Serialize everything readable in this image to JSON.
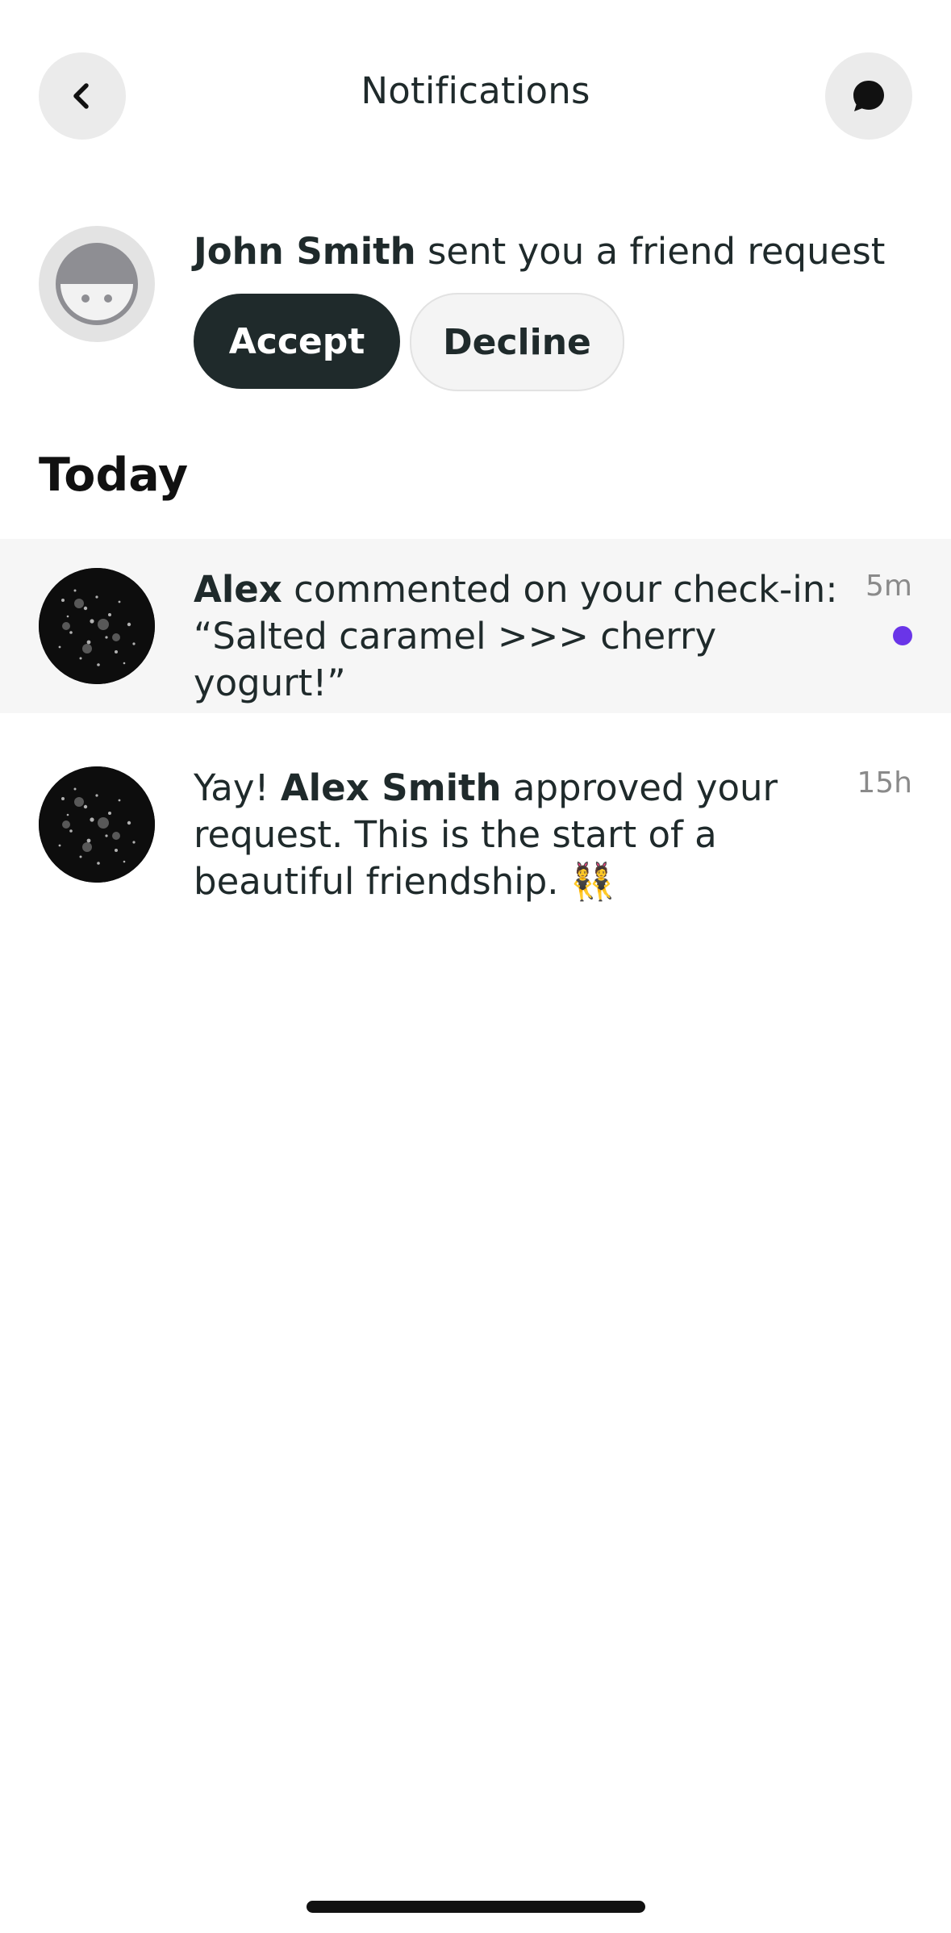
{
  "header": {
    "title": "Notifications",
    "back_icon": "chevron-left-icon",
    "chat_icon": "chat-bubble-icon"
  },
  "friend_request": {
    "name": "John Smith",
    "text": " sent you a friend request",
    "accept_label": "Accept",
    "decline_label": "Decline",
    "avatar_icon": "default-avatar-icon"
  },
  "section": {
    "title": "Today"
  },
  "notifications": [
    {
      "name": "Alex",
      "line1": " commented on your check-in:",
      "line2": "“Salted caramel >>> cherry yogurt!”",
      "time": "5m",
      "unread": true
    },
    {
      "prefix": "Yay! ",
      "name": "Alex Smith",
      "text": " approved your request. This is the start of a beautiful friendship. ",
      "emoji": "👯",
      "time": "15h",
      "unread": false
    }
  ],
  "colors": {
    "accent": "#6a35e8",
    "primary_button": "#1f2a2b",
    "highlight_row": "#f6f6f6"
  }
}
